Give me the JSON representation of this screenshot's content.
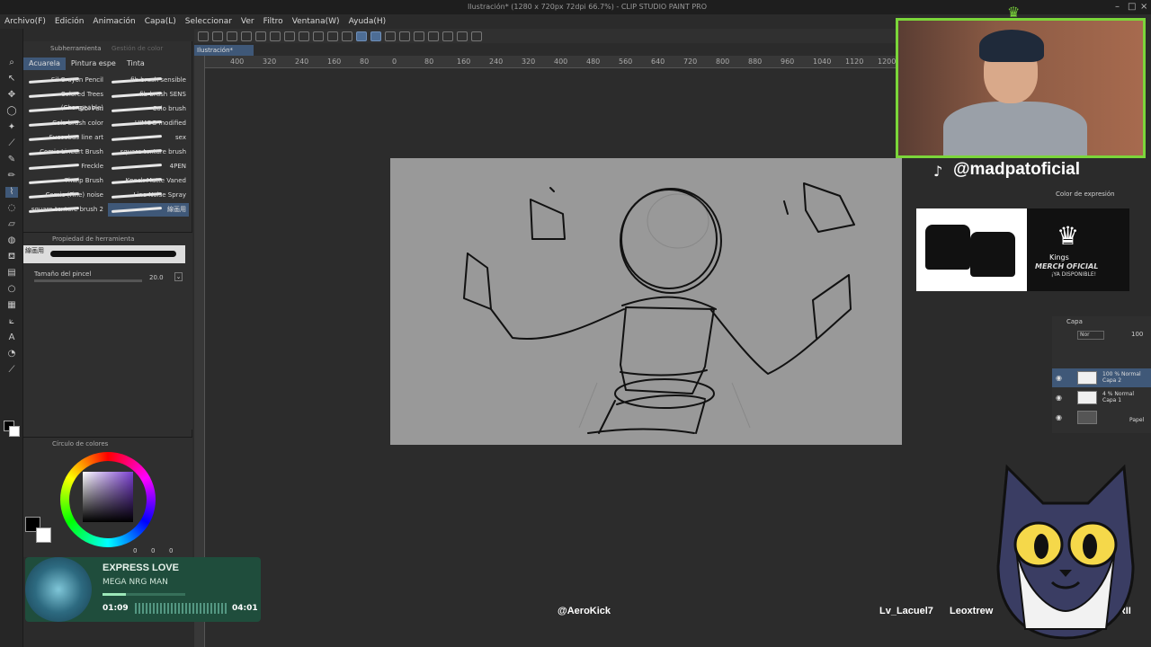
{
  "window": {
    "title": "Ilustración* (1280 x 720px 72dpi 66.7%) - CLIP STUDIO PAINT PRO"
  },
  "menu": [
    "Archivo(F)",
    "Edición",
    "Animación",
    "Capa(L)",
    "Seleccionar",
    "Ver",
    "Filtro",
    "Ventana(W)",
    "Ayuda(H)"
  ],
  "document_tab": "Ilustración*",
  "brush_panel": {
    "subtabs": [
      "Subherramienta",
      "Gestión de color"
    ],
    "tabs": [
      "Acuarela",
      "Pintura espe",
      "Tinta"
    ],
    "brushes_left": [
      "Sil Crayon Pencil",
      "Colored Trees (Changeable)",
      "Bibi Pen",
      "Cola brush color",
      "Succubus line art",
      "Comic Lineart Brush",
      "Freckle",
      "Thwip Brush",
      "Comic (Fine) noise",
      "square texture brush 2"
    ],
    "brushes_right": [
      "fib brush sensible",
      "fib brush SENS",
      "Colo brush",
      "HIMOG modified",
      "sex",
      "square texture brush",
      "4PEN",
      "Knock Matte Vaned",
      "Line Noise Spray",
      "線画用"
    ]
  },
  "tool_property": {
    "header": "Propiedad de herramienta",
    "preview_label": "線画用",
    "brush_size_label": "Tamaño del pincel",
    "brush_size_value": "20.0"
  },
  "color_panel": {
    "header": "Círculo de colores",
    "readout": [
      "0",
      "0",
      "0"
    ],
    "accent_hue": "#7a3fd0"
  },
  "ruler_ticks": [
    "400",
    "320",
    "240",
    "160",
    "80",
    "0",
    "80",
    "160",
    "240",
    "320",
    "400",
    "480",
    "560",
    "640",
    "720",
    "800",
    "880",
    "960",
    "1040",
    "1120",
    "1200"
  ],
  "layer_panel": {
    "header": "Capa",
    "blend": "Nor",
    "opacity": "100",
    "layers": [
      {
        "opacity_mode": "100 % Normal",
        "name": "Capa 2",
        "selected": true
      },
      {
        "opacity_mode": "4 % Normal",
        "name": "Capa 1",
        "selected": false
      },
      {
        "opacity_mode": "",
        "name": "Papel",
        "selected": false
      }
    ]
  },
  "expression_color": "Color de expresión",
  "stream_overlay": {
    "handle": "@madpatoficial",
    "merch": {
      "brand": "Kings",
      "line": "MERCH OFICIAL",
      "available": "¡YA DISPONIBLE!"
    },
    "music": {
      "song": "EXPRESS LOVE",
      "artist": "MEGA NRG MAN",
      "elapsed": "01:09",
      "total": "04:01",
      "progress": 0.286
    },
    "viewers": [
      "@AeroKick",
      "Lv_Lacuel7",
      "Leoxtrew",
      "LV_RODRII"
    ]
  }
}
